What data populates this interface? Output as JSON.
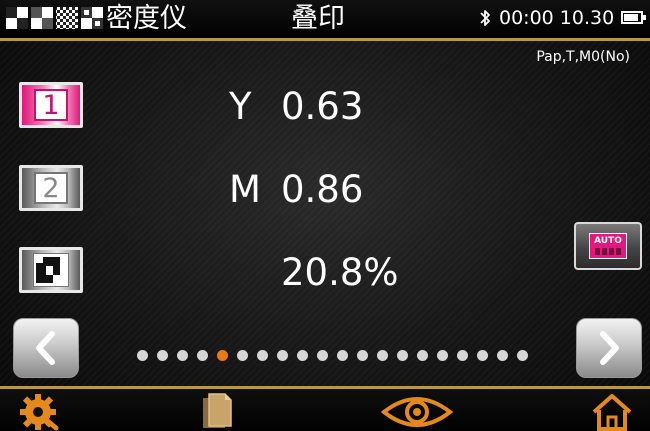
{
  "header": {
    "app_name": "密度仪",
    "mode_title": "叠印",
    "clock": "00:00 10.30",
    "battery_level": 0.9
  },
  "reference": "Pap,T,M0(No)",
  "channels": [
    {
      "key_label": "1",
      "name": "Y",
      "value": "0.63"
    },
    {
      "key_label": "2",
      "name": "M",
      "value": "0.86"
    },
    {
      "key_label": "",
      "name": "",
      "value": "20.8%"
    }
  ],
  "auto_button": {
    "label": "AUTO"
  },
  "pagination": {
    "count": 20,
    "current": 4
  },
  "colors": {
    "accent_gold": "#b89a46",
    "magenta": "#e2187d",
    "active_dot": "#e87a16"
  },
  "icons": {
    "logo": "checkerboard-logo",
    "status": [
      "bluetooth-icon",
      "battery-icon"
    ],
    "toolbar": [
      "settings-gear-icon",
      "files-icon",
      "eye-icon",
      "home-icon"
    ]
  }
}
